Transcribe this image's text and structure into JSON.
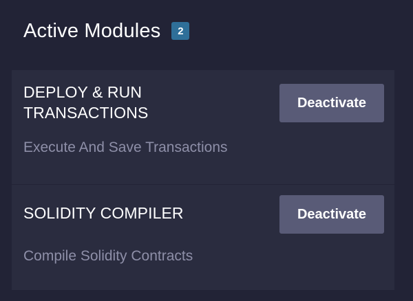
{
  "header": {
    "title": "Active Modules",
    "count": "2"
  },
  "modules": [
    {
      "title": "DEPLOY & RUN TRANSACTIONS",
      "description": "Execute And Save Transactions",
      "action_label": "Deactivate"
    },
    {
      "title": "SOLIDITY COMPILER",
      "description": "Compile Solidity Contracts",
      "action_label": "Deactivate"
    }
  ],
  "colors": {
    "background": "#222336",
    "card": "#2a2c3f",
    "badge": "#2f6f99",
    "button": "#595b77",
    "muted_text": "#8e8fa8"
  }
}
